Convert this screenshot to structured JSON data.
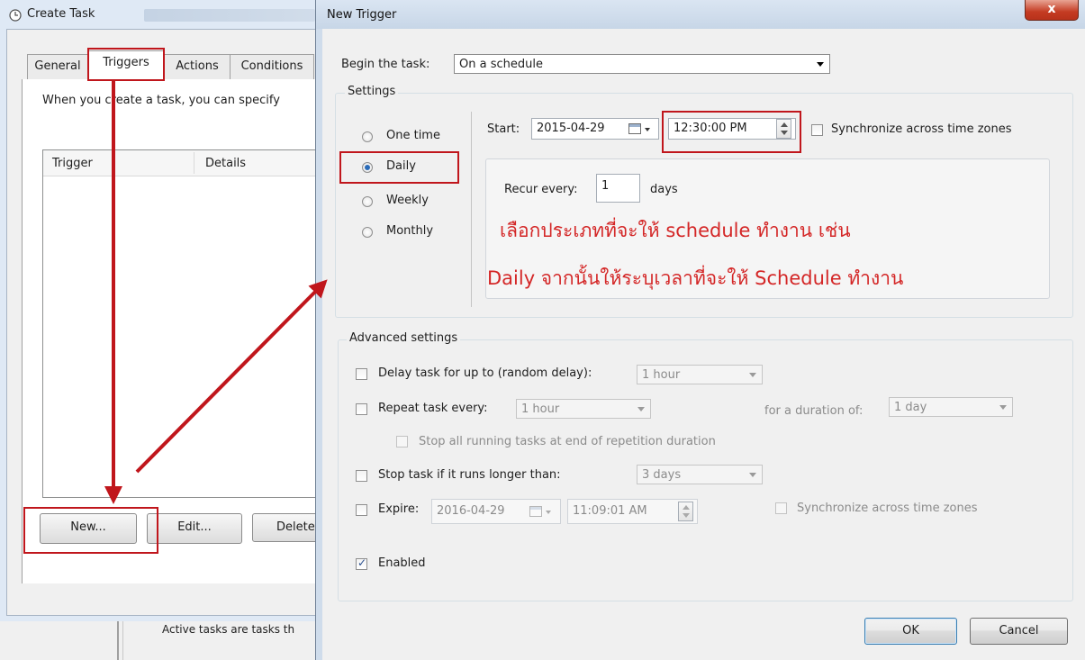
{
  "create_task": {
    "title": "Create Task",
    "tabs": [
      "General",
      "Triggers",
      "Actions",
      "Conditions"
    ],
    "description": "When you create a task, you can specify",
    "columns": [
      "Trigger",
      "Details"
    ],
    "buttons": {
      "new": "New...",
      "edit": "Edit...",
      "delete": "Delete"
    }
  },
  "background": {
    "active_tasks_text": "Active tasks are tasks th"
  },
  "new_trigger": {
    "title": "New Trigger",
    "close_label": "x",
    "begin_label": "Begin the task:",
    "begin_value": "On a schedule",
    "settings": {
      "title": "Settings",
      "radios": [
        {
          "label": "One time",
          "selected": false
        },
        {
          "label": "Daily",
          "selected": true
        },
        {
          "label": "Weekly",
          "selected": false
        },
        {
          "label": "Monthly",
          "selected": false
        }
      ],
      "start_label": "Start:",
      "start_date": "2015-04-29",
      "start_time": "12:30:00 PM",
      "sync_label": "Synchronize across time zones",
      "recur_label": "Recur every:",
      "recur_value": "1",
      "recur_unit": "days"
    },
    "annotation": {
      "line1": "เลือกประเภทที่จะให้ schedule ทำงาน เช่น",
      "line2": "Daily จากนั้นให้ระบุเวลาที่จะให้ Schedule ทำงาน",
      "color": "#d42727"
    },
    "advanced": {
      "title": "Advanced settings",
      "delay_label": "Delay task for up to (random delay):",
      "delay_value": "1 hour",
      "repeat_label": "Repeat task every:",
      "repeat_value": "1 hour",
      "duration_label": "for a duration of:",
      "duration_value": "1 day",
      "stop_running_label": "Stop all running tasks at end of repetition duration",
      "stop_longer_label": "Stop task if it runs longer than:",
      "stop_longer_value": "3 days",
      "expire_label": "Expire:",
      "expire_date": "2016-04-29",
      "expire_time": "11:09:01 AM",
      "expire_sync_label": "Synchronize across time zones",
      "enabled_label": "Enabled"
    },
    "ok_label": "OK",
    "cancel_label": "Cancel"
  },
  "colors": {
    "highlight": "#c0161c",
    "arrow": "#c0161c"
  }
}
